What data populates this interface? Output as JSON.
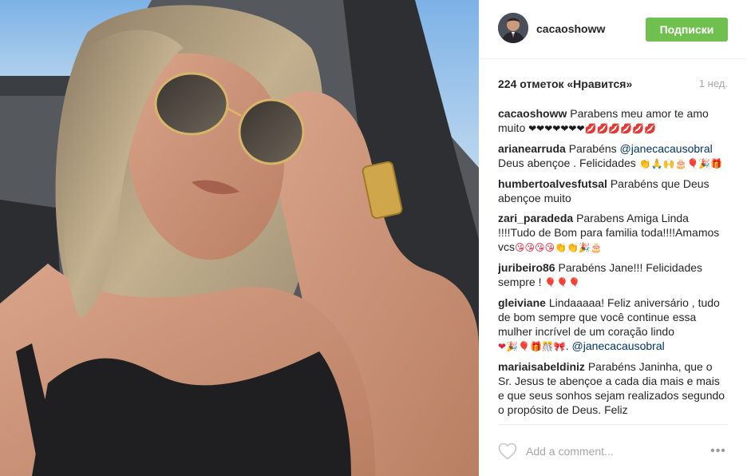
{
  "post": {
    "photo_icon": "photo-selfie",
    "author": {
      "username": "cacaoshoww",
      "avatar_icon": "avatar-man"
    },
    "follow_label": "Подписки",
    "likes_text": "224 отметок «Нравится»",
    "time_text": "1 нед."
  },
  "comments": [
    {
      "author": "cacaoshoww",
      "text": "Parabens meu amor te amo muito ",
      "emojis": [
        {
          "glyph": "❤❤❤❤❤❤❤",
          "cls": "em-heart"
        },
        {
          "glyph": "💋💋💋💋💋💋",
          "cls": "em-kiss"
        }
      ]
    },
    {
      "author": "arianearruda",
      "text": "Parabéns ",
      "mention": "@janecacausobral",
      "text2": " Deus abençoe . Felicidades ",
      "emojis": [
        {
          "glyph": "👏🙏🙌🎂🎈🎉🎁",
          "cls": "em-red"
        }
      ]
    },
    {
      "author": "humbertoalvesfutsal",
      "text": "Parabéns que Deus abençoe muito"
    },
    {
      "author": "zari_paradeda",
      "text": "Parabens Amiga Linda !!!!Tudo de Bom para familia toda!!!!Amamos vcs",
      "emojis": [
        {
          "glyph": "😘😘😘😘👏👏🎉🎂",
          "cls": "em-red"
        }
      ]
    },
    {
      "author": "juribeiro86",
      "text": "Parabéns Jane!!! Felicidades sempre ! ",
      "emojis": [
        {
          "glyph": "🎈🎈🎈",
          "cls": "em-red"
        }
      ]
    },
    {
      "author": "gleiviane",
      "text": "Lindaaaaa! Feliz aniversário , tudo de bom sempre que você continue essa mulher incrível de um coração lindo",
      "emojis": [
        {
          "glyph": "❤🎉🎈🎁🎊🎀",
          "cls": "em-red"
        }
      ],
      "text2": ". ",
      "mention": "@janecacausobral"
    },
    {
      "author": "mariaisabeldiniz",
      "text": "Parabéns Janinha, que o Sr. Jesus te abençoe a cada dia mais e mais e que seus sonhos sejam realizados segundo o propósito de Deus. Feliz"
    }
  ],
  "footer": {
    "comment_placeholder": "Add a comment...",
    "like_icon": "heart-outline-icon",
    "more_icon": "more-options-icon",
    "more_label": "•••"
  }
}
